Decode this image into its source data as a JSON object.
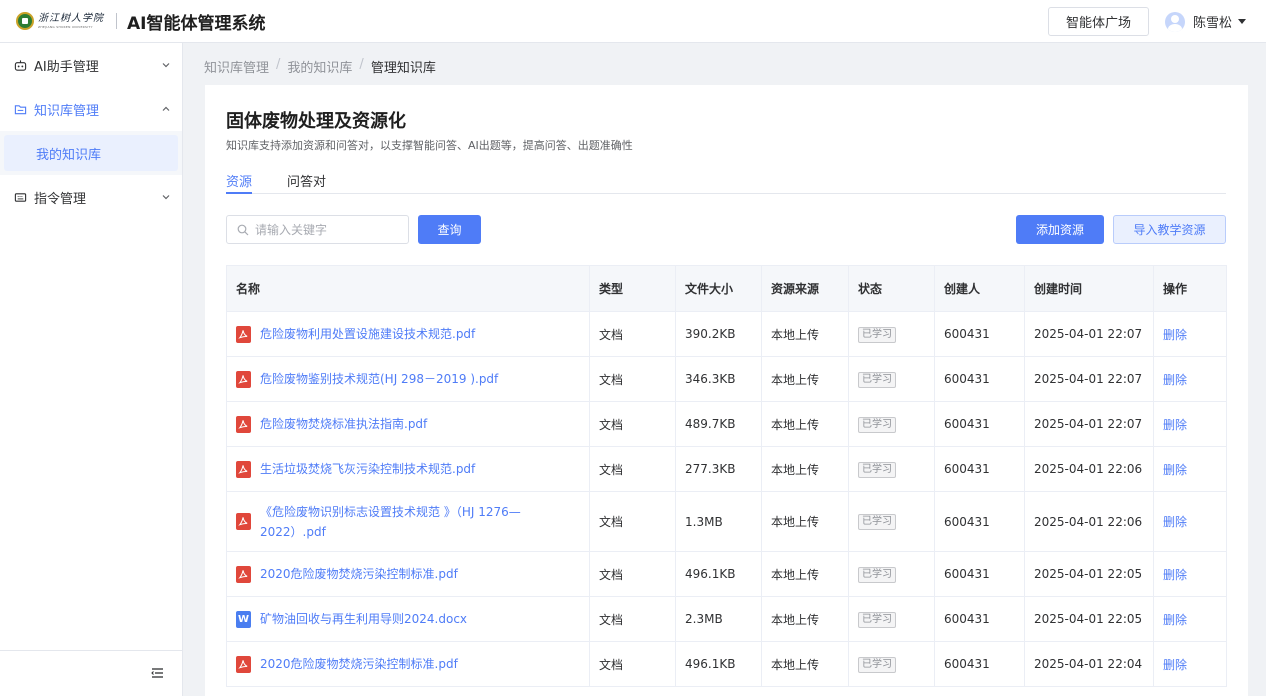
{
  "header": {
    "logo_cn": "浙江树人学院",
    "logo_en": "ZHEJIANG SHUREN UNIVERSITY",
    "app_title": "AI智能体管理系统",
    "plaza_button": "智能体广场",
    "user_name": "陈雪松"
  },
  "sidebar": {
    "items": [
      {
        "label": "AI助手管理",
        "icon": "robot-icon"
      },
      {
        "label": "知识库管理",
        "icon": "folder-icon",
        "active": true
      },
      {
        "label": "我的知识库",
        "sub": true
      },
      {
        "label": "指令管理",
        "icon": "keyboard-icon"
      }
    ]
  },
  "breadcrumb": [
    "知识库管理",
    "我的知识库",
    "管理知识库"
  ],
  "kb": {
    "title": "固体废物处理及资源化",
    "description": "知识库支持添加资源和问答对，以支撑智能问答、AI出题等，提高问答、出题准确性"
  },
  "tabs": [
    "资源",
    "问答对"
  ],
  "search": {
    "placeholder": "请输入关键字",
    "button": "查询"
  },
  "actions": {
    "add": "添加资源",
    "import": "导入教学资源"
  },
  "table": {
    "columns": [
      "名称",
      "类型",
      "文件大小",
      "资源来源",
      "状态",
      "创建人",
      "创建时间",
      "操作"
    ],
    "rows": [
      {
        "name": "危险废物利用处置设施建设技术规范.pdf",
        "filetype": "pdf",
        "type": "文档",
        "size": "390.2KB",
        "source": "本地上传",
        "status": "已学习",
        "creator": "600431",
        "time": "2025-04-01 22:07",
        "op": "删除"
      },
      {
        "name": "危险废物鉴别技术规范(HJ 298－2019 ).pdf",
        "filetype": "pdf",
        "type": "文档",
        "size": "346.3KB",
        "source": "本地上传",
        "status": "已学习",
        "creator": "600431",
        "time": "2025-04-01 22:07",
        "op": "删除"
      },
      {
        "name": "危险废物焚烧标准执法指南.pdf",
        "filetype": "pdf",
        "type": "文档",
        "size": "489.7KB",
        "source": "本地上传",
        "status": "已学习",
        "creator": "600431",
        "time": "2025-04-01 22:07",
        "op": "删除"
      },
      {
        "name": "生活垃圾焚烧飞灰污染控制技术规范.pdf",
        "filetype": "pdf",
        "type": "文档",
        "size": "277.3KB",
        "source": "本地上传",
        "status": "已学习",
        "creator": "600431",
        "time": "2025-04-01 22:06",
        "op": "删除"
      },
      {
        "name": "《危险废物识别标志设置技术规范 》（HJ 1276—2022）.pdf",
        "filetype": "pdf",
        "type": "文档",
        "size": "1.3MB",
        "source": "本地上传",
        "status": "已学习",
        "creator": "600431",
        "time": "2025-04-01 22:06",
        "op": "删除",
        "tall": true
      },
      {
        "name": "2020危险废物焚烧污染控制标准.pdf",
        "filetype": "pdf",
        "type": "文档",
        "size": "496.1KB",
        "source": "本地上传",
        "status": "已学习",
        "creator": "600431",
        "time": "2025-04-01 22:05",
        "op": "删除"
      },
      {
        "name": "矿物油回收与再生利用导则2024.docx",
        "filetype": "docx",
        "type": "文档",
        "size": "2.3MB",
        "source": "本地上传",
        "status": "已学习",
        "creator": "600431",
        "time": "2025-04-01 22:05",
        "op": "删除"
      },
      {
        "name": "2020危险废物焚烧污染控制标准.pdf",
        "filetype": "pdf",
        "type": "文档",
        "size": "496.1KB",
        "source": "本地上传",
        "status": "已学习",
        "creator": "600431",
        "time": "2025-04-01 22:04",
        "op": "删除"
      }
    ]
  },
  "colors": {
    "accent": "#4f7cf7",
    "pdf": "#e0473b",
    "doc": "#4a7ef0"
  }
}
